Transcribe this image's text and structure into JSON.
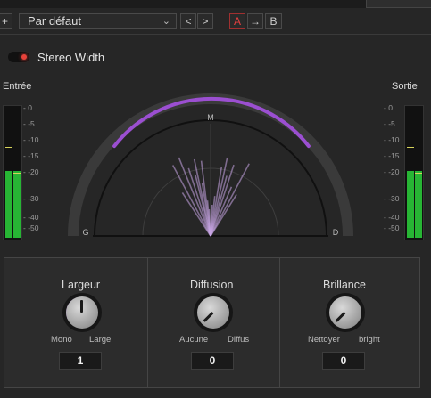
{
  "toolbar": {
    "plus": "+",
    "preset": "Par défaut",
    "prev": "<",
    "next": ">",
    "a_label": "A",
    "copy_label": "→",
    "b_label": "B"
  },
  "plugin": {
    "name": "Stereo Width",
    "enabled": true
  },
  "input": {
    "label": "Entrée",
    "level_left_db": -20,
    "level_right_db": -20,
    "peak_left_db": -12,
    "peak_right_db": -20
  },
  "output": {
    "label": "Sortie",
    "level_left_db": -20,
    "level_right_db": -20,
    "peak_left_db": -12,
    "peak_right_db": -20
  },
  "scale_labels": [
    "0",
    "-5",
    "-10",
    "-15",
    "-20",
    "-30",
    "-40",
    "-50"
  ],
  "scope": {
    "mid_label": "M",
    "left_label": "G",
    "right_label": "D"
  },
  "knobs": [
    {
      "title": "Largeur",
      "min_label": "Mono",
      "max_label": "Large",
      "value": "1"
    },
    {
      "title": "Diffusion",
      "min_label": "Aucune",
      "max_label": "Diffus",
      "value": "0"
    },
    {
      "title": "Brillance",
      "min_label": "Nettoyer",
      "max_label": "bright",
      "value": "0"
    }
  ],
  "colors": {
    "accent": "#9b4fd1",
    "meter": "#27b534",
    "power_on": "#e8423a",
    "background": "#262626"
  }
}
